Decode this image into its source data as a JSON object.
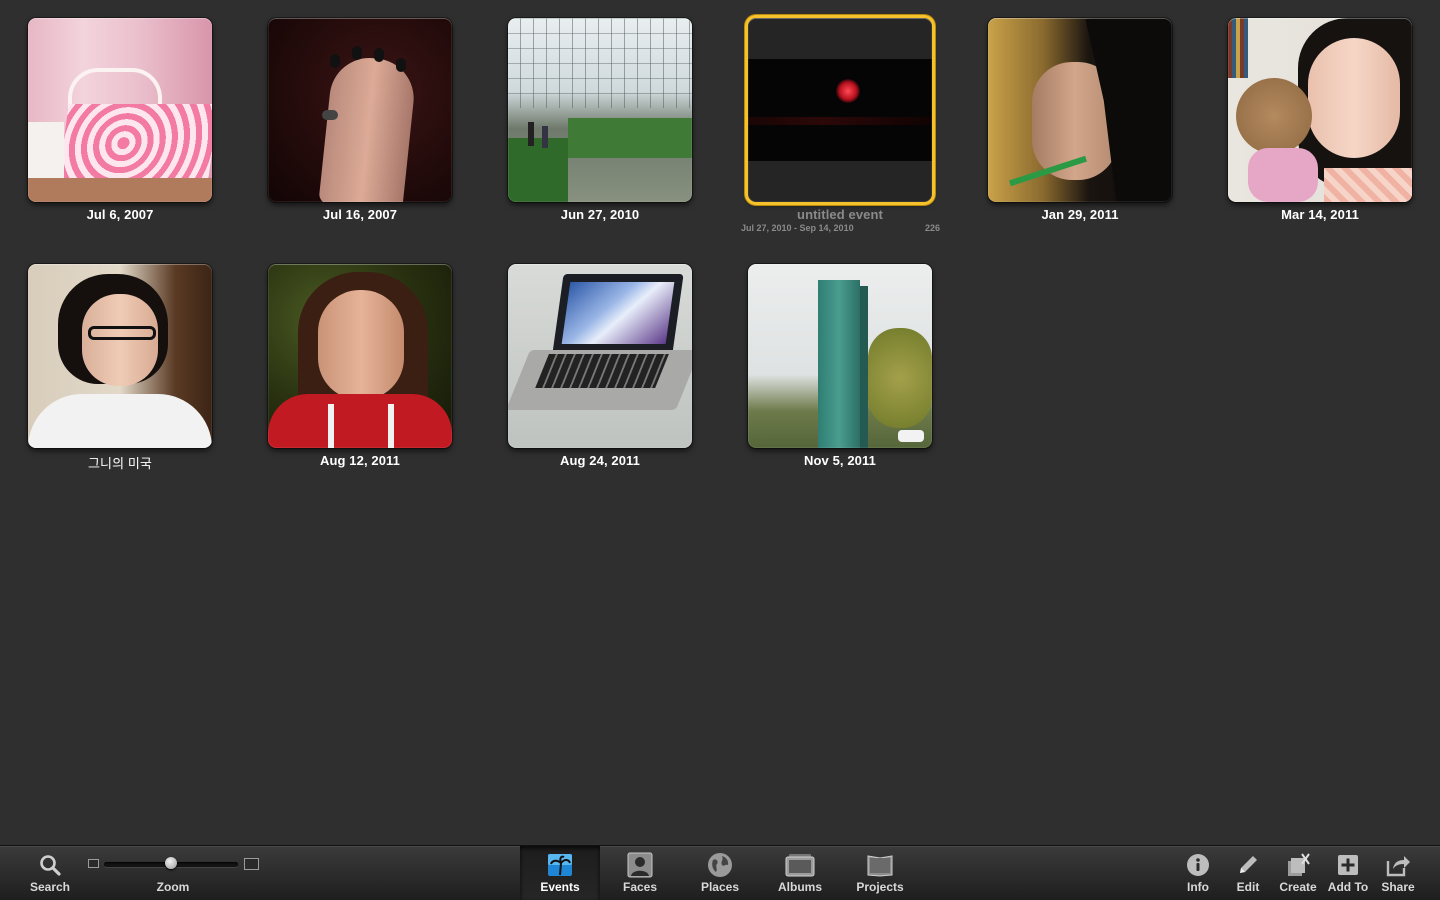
{
  "events": [
    {
      "caption": "Jul 6, 2007"
    },
    {
      "caption": "Jul 16, 2007"
    },
    {
      "caption": "Jun 27, 2010"
    },
    {
      "caption": "untitled event",
      "date_range": "Jul 27, 2010 - Sep 14, 2010",
      "count": "226"
    },
    {
      "caption": "Jan 29, 2011"
    },
    {
      "caption": "Mar 14, 2011"
    },
    {
      "caption": "그니의 미국"
    },
    {
      "caption": "Aug 12, 2011"
    },
    {
      "caption": "Aug 24, 2011"
    },
    {
      "caption": "Nov 5, 2011"
    }
  ],
  "toolbar": {
    "search": "Search",
    "zoom": "Zoom",
    "zoom_level": 0.5,
    "tabs": [
      "Events",
      "Faces",
      "Places",
      "Albums",
      "Projects"
    ],
    "active_tab": "Events",
    "actions": [
      "Info",
      "Edit",
      "Create",
      "Add To",
      "Share"
    ]
  },
  "colors": {
    "background": "#2f2f2f",
    "selection": "#f6c22c",
    "events_icon": "#3aa3e8"
  },
  "icons": {
    "search": "magnifier-icon",
    "events": "palm-tree-icon",
    "faces": "portrait-icon",
    "places": "globe-icon",
    "albums": "album-icon",
    "projects": "book-icon",
    "info": "info-icon",
    "edit": "pencil-icon",
    "create": "create-icon",
    "add_to": "plus-icon",
    "share": "share-icon"
  }
}
